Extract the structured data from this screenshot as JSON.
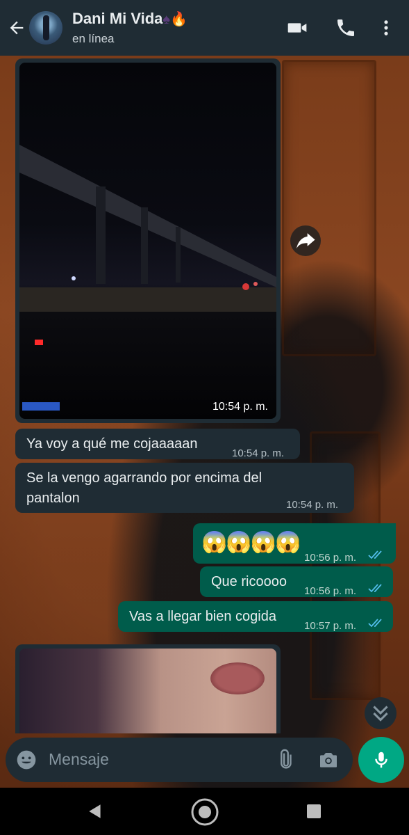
{
  "header": {
    "contact_name": "Dani Mi Vida",
    "status": "en línea",
    "icons": [
      "back-arrow-icon",
      "video-call-icon",
      "phone-call-icon",
      "more-options-icon"
    ]
  },
  "messages": [
    {
      "type": "video",
      "direction": "in",
      "time": "10:54 p. m."
    },
    {
      "type": "text",
      "direction": "in",
      "text": "Ya voy a qué me cojaaaaan",
      "time": "10:54 p. m."
    },
    {
      "type": "text",
      "direction": "in",
      "text_line1": "Se la vengo agarrando por encima del",
      "text_line2": "pantalon",
      "time": "10:54 p. m."
    },
    {
      "type": "emoji",
      "direction": "out",
      "text": "😱😱😱😱",
      "time": "10:56 p. m.",
      "read": true
    },
    {
      "type": "text",
      "direction": "out",
      "text": "Que ricoooo",
      "time": "10:56 p. m.",
      "read": true
    },
    {
      "type": "text",
      "direction": "out",
      "text": "Vas a llegar bien cogida",
      "time": "10:57 p. m.",
      "read": true
    },
    {
      "type": "image",
      "direction": "in"
    }
  ],
  "composer": {
    "placeholder": "Mensaje",
    "icons": [
      "emoji-icon",
      "attach-icon",
      "camera-icon",
      "microphone-icon"
    ]
  },
  "system_nav": [
    "back-triangle-icon",
    "home-circle-icon",
    "recents-square-icon"
  ],
  "colors": {
    "header_bg": "#1f2c34",
    "incoming_bubble": "#1f2c34",
    "outgoing_bubble": "#005c4b",
    "accent": "#00a884",
    "read_ticks": "#53bdeb"
  }
}
